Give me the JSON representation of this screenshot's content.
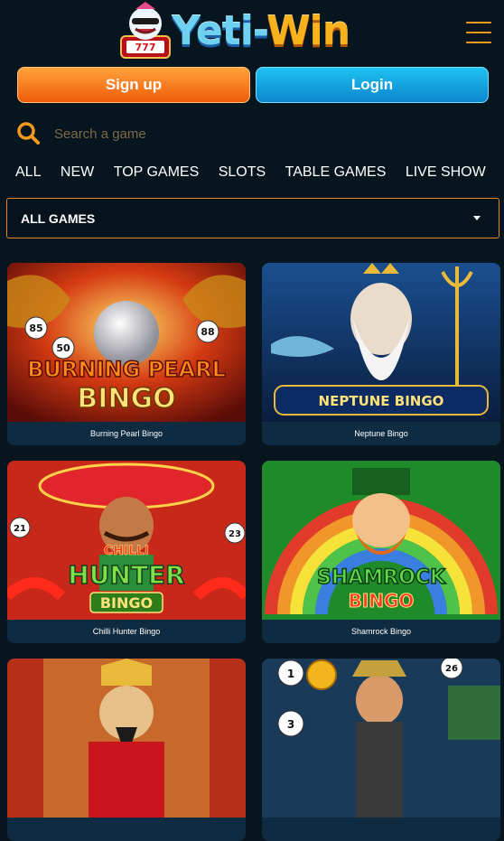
{
  "brand": {
    "name_part1": "Yeti-",
    "name_part2": "Win"
  },
  "auth": {
    "signup_label": "Sign up",
    "login_label": "Login"
  },
  "search": {
    "placeholder": "Search a game"
  },
  "tabs": [
    "ALL",
    "NEW",
    "TOP GAMES",
    "SLOTS",
    "TABLE GAMES",
    "LIVE SHOW",
    "O"
  ],
  "filter": {
    "selected": "ALL GAMES"
  },
  "games": [
    {
      "title": "Burning Pearl Bingo",
      "art_line1": "BURNING PEARL",
      "art_line2": "BINGO",
      "balls": [
        "85",
        "50",
        "88"
      ]
    },
    {
      "title": "Neptune Bingo",
      "art_line1": "NEPTUNE",
      "art_line2": "BINGO"
    },
    {
      "title": "Chilli Hunter Bingo",
      "art_line1": "HUNTER",
      "art_line2": "BINGO",
      "art_line0": "CHILLI",
      "balls": [
        "21",
        "23"
      ]
    },
    {
      "title": "Shamrock Bingo",
      "art_line1": "SHAMROCK",
      "art_line2": "BINGO"
    },
    {
      "title": "",
      "art_line1": "",
      "art_line2": ""
    },
    {
      "title": "",
      "art_line1": "",
      "art_line2": "",
      "balls": [
        "1",
        "3",
        "26"
      ]
    }
  ],
  "colors": {
    "accent_orange": "#f39a1c",
    "accent_blue": "#1fc2f0",
    "background": "#07151f"
  }
}
